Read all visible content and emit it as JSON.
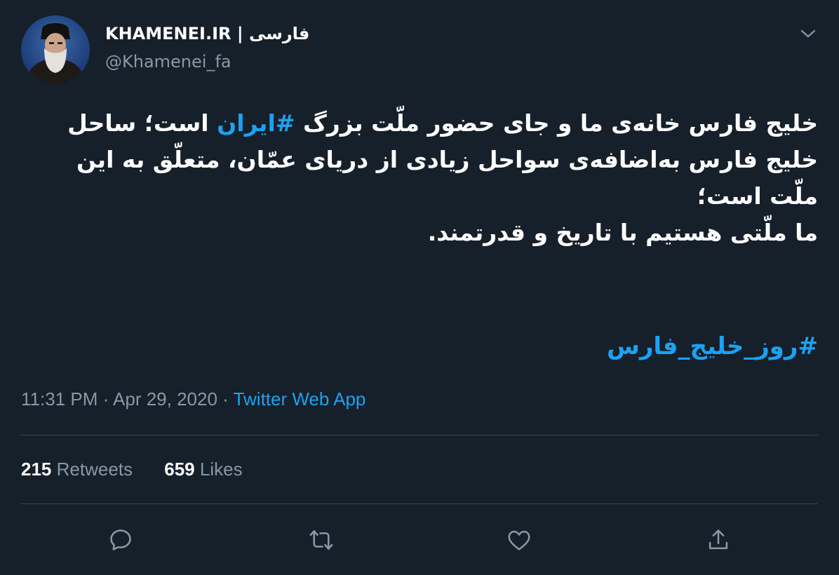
{
  "author": {
    "name": "KHAMENEI.IR | فارسی",
    "handle": "@Khamenei_fa",
    "avatar": "profile-photo"
  },
  "tweet": {
    "lines": [
      {
        "before": "خلیج فارس خانه‌ی ما و جای حضور ملّت بزرگ ",
        "hashtag": "#ایران",
        "after": " است؛ ساحل"
      },
      {
        "text": "خلیج فارس به‌اضافه‌ی سواحل زیادی از دریای عمّان، متعلّق به این"
      },
      {
        "text": "ملّت است؛"
      },
      {
        "text": "ما ملّتی هستیم با تاریخ و قدرتمند."
      }
    ],
    "hashtag_line": "#روز_خلیج_فارس"
  },
  "meta": {
    "time": "11:31 PM",
    "separator": " · ",
    "date": "Apr 29, 2020",
    "source": "Twitter Web App"
  },
  "stats": {
    "retweets_count": "215",
    "retweets_label": "Retweets",
    "likes_count": "659",
    "likes_label": "Likes"
  },
  "actions": {
    "icons": [
      "reply-icon",
      "retweet-icon",
      "like-icon",
      "share-icon"
    ]
  },
  "colors": {
    "background": "#15202b",
    "text": "#ffffff",
    "secondary": "#8899a6",
    "accent": "#1da1f2",
    "divider": "#38444d"
  }
}
